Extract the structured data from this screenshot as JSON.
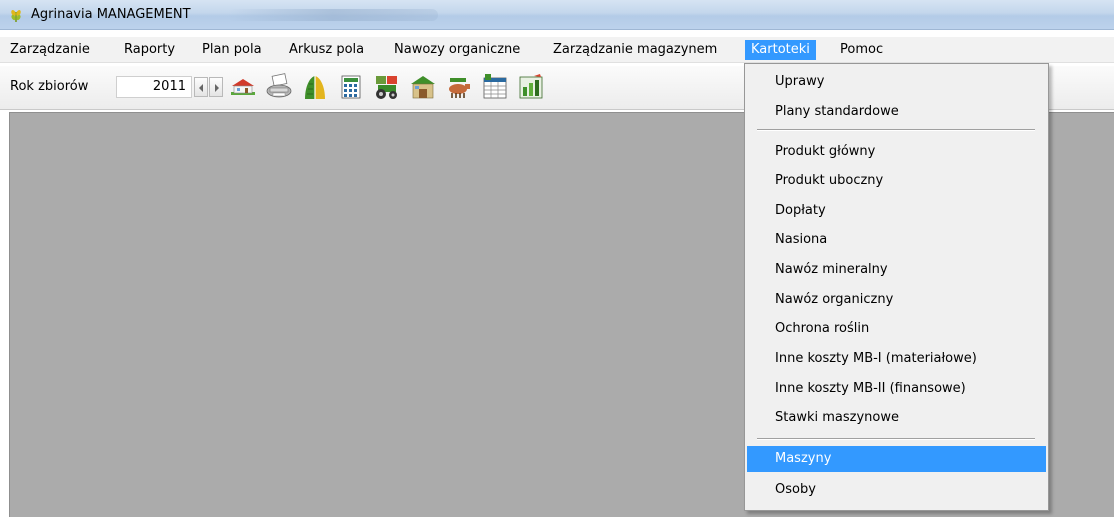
{
  "window": {
    "title": "Agrinavia MANAGEMENT"
  },
  "menubar": {
    "items": [
      {
        "label": "Zarządzanie"
      },
      {
        "label": "Raporty"
      },
      {
        "label": "Plan pola"
      },
      {
        "label": "Arkusz pola"
      },
      {
        "label": "Nawozy organiczne"
      },
      {
        "label": "Zarządzanie magazynem"
      },
      {
        "label": "Kartoteki"
      },
      {
        "label": "Pomoc"
      }
    ],
    "active": "Kartoteki"
  },
  "toolbar": {
    "year_label": "Rok zbiorów",
    "year_value": "2011",
    "icons": [
      "farm-house-icon",
      "printer-icon",
      "crop-field-icon",
      "calculator-sheet-icon",
      "machinery-tractor-icon",
      "storage-shed-icon",
      "livestock-icon",
      "report-table-icon",
      "chart-edit-icon"
    ]
  },
  "dropdown": {
    "items": [
      {
        "label": "Uprawy"
      },
      {
        "label": "Plany standardowe"
      },
      {
        "label": "Produkt główny"
      },
      {
        "label": "Produkt uboczny"
      },
      {
        "label": "Dopłaty"
      },
      {
        "label": "Nasiona"
      },
      {
        "label": "Nawóz mineralny"
      },
      {
        "label": "Nawóz organiczny"
      },
      {
        "label": "Ochrona roślin"
      },
      {
        "label": "Inne koszty MB-I (materiałowe)"
      },
      {
        "label": "Inne koszty MB-II (finansowe)"
      },
      {
        "label": "Stawki maszynowe"
      },
      {
        "label": "Maszyny"
      },
      {
        "label": "Osoby"
      }
    ],
    "selected": "Maszyny"
  },
  "colors": {
    "highlight": "#3399ff",
    "workspace": "#ababab",
    "menu_bg": "#f0f0f0"
  }
}
